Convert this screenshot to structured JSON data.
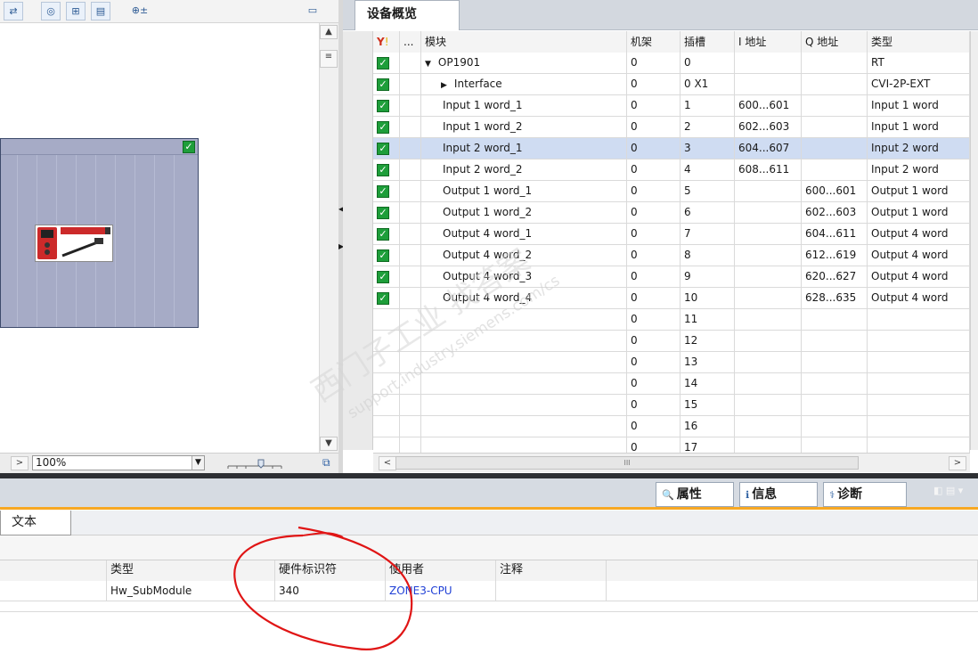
{
  "left_panel": {
    "zoom_value": "100%",
    "scroll_left_symbol": ">",
    "dropdown_symbol": "▼"
  },
  "overview": {
    "tab_label": "设备概览",
    "columns": [
      "模块",
      "机架",
      "插槽",
      "I 地址",
      "Q 地址",
      "类型"
    ],
    "ellipsis": "...",
    "rows": [
      {
        "module": "OP1901",
        "rack": "0",
        "slot": "0",
        "i": "",
        "q": "",
        "type": "RT",
        "checked": true,
        "expander": "▼"
      },
      {
        "module": "Interface",
        "rack": "0",
        "slot": "0 X1",
        "i": "",
        "q": "",
        "type": "CVI-2P-EXT",
        "checked": true,
        "expander": "▶"
      },
      {
        "module": "Input 1 word_1",
        "rack": "0",
        "slot": "1",
        "i": "600...601",
        "q": "",
        "type": "Input 1 word",
        "checked": true
      },
      {
        "module": "Input 1 word_2",
        "rack": "0",
        "slot": "2",
        "i": "602...603",
        "q": "",
        "type": "Input 1 word",
        "checked": true
      },
      {
        "module": "Input 2 word_1",
        "rack": "0",
        "slot": "3",
        "i": "604...607",
        "q": "",
        "type": "Input 2 word",
        "checked": true,
        "selected": true
      },
      {
        "module": "Input 2 word_2",
        "rack": "0",
        "slot": "4",
        "i": "608...611",
        "q": "",
        "type": "Input 2 word",
        "checked": true
      },
      {
        "module": "Output 1 word_1",
        "rack": "0",
        "slot": "5",
        "i": "",
        "q": "600...601",
        "type": "Output 1 word",
        "checked": true
      },
      {
        "module": "Output 1 word_2",
        "rack": "0",
        "slot": "6",
        "i": "",
        "q": "602...603",
        "type": "Output 1 word",
        "checked": true
      },
      {
        "module": "Output 4 word_1",
        "rack": "0",
        "slot": "7",
        "i": "",
        "q": "604...611",
        "type": "Output 4 word",
        "checked": true
      },
      {
        "module": "Output 4 word_2",
        "rack": "0",
        "slot": "8",
        "i": "",
        "q": "612...619",
        "type": "Output 4 word",
        "checked": true
      },
      {
        "module": "Output 4 word_3",
        "rack": "0",
        "slot": "9",
        "i": "",
        "q": "620...627",
        "type": "Output 4 word",
        "checked": true
      },
      {
        "module": "Output 4 word_4",
        "rack": "0",
        "slot": "10",
        "i": "",
        "q": "628...635",
        "type": "Output 4 word",
        "checked": true
      },
      {
        "module": "",
        "rack": "0",
        "slot": "11",
        "i": "",
        "q": "",
        "type": "",
        "checked": false
      },
      {
        "module": "",
        "rack": "0",
        "slot": "12",
        "i": "",
        "q": "",
        "type": "",
        "checked": false
      },
      {
        "module": "",
        "rack": "0",
        "slot": "13",
        "i": "",
        "q": "",
        "type": "",
        "checked": false
      },
      {
        "module": "",
        "rack": "0",
        "slot": "14",
        "i": "",
        "q": "",
        "type": "",
        "checked": false
      },
      {
        "module": "",
        "rack": "0",
        "slot": "15",
        "i": "",
        "q": "",
        "type": "",
        "checked": false
      },
      {
        "module": "",
        "rack": "0",
        "slot": "16",
        "i": "",
        "q": "",
        "type": "",
        "checked": false
      },
      {
        "module": "",
        "rack": "0",
        "slot": "17",
        "i": "",
        "q": "",
        "type": "",
        "checked": false
      }
    ],
    "hscroll_left": "<",
    "hscroll_right": ">",
    "hscroll_grip": "III"
  },
  "inspector": {
    "tabs": [
      {
        "label": "属性",
        "icon": "properties-icon"
      },
      {
        "label": "信息",
        "icon": "info-icon"
      },
      {
        "label": "诊断",
        "icon": "diagnostics-icon"
      }
    ],
    "text_tab": "文本",
    "table_headers": [
      "类型",
      "硬件标识符",
      "使用者",
      "注释"
    ],
    "table_rows": [
      {
        "type": "Hw_SubModule",
        "hw_id": "340",
        "user": "ZONE3-CPU",
        "comment": ""
      }
    ]
  },
  "watermark": {
    "cn": "西门子工业 找答案",
    "url": "support.industry.siemens.com/cs"
  },
  "colors": {
    "check_green": "#1e9e3a",
    "link_blue": "#1f3fd6",
    "annotation_red": "#e01515",
    "accent_orange": "#f7a823"
  }
}
